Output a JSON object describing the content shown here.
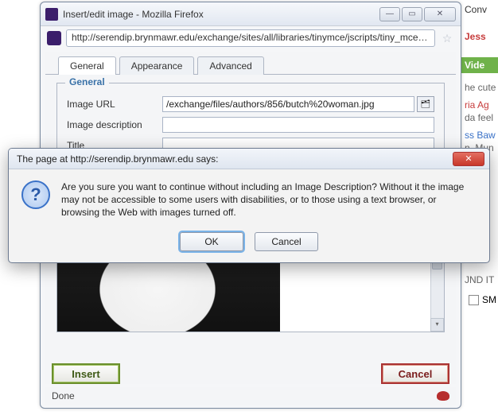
{
  "background": {
    "right_fragments": [
      "Conv",
      "Jess",
      "Vide",
      "he cute",
      "ria Ag",
      "da feel",
      "ss Baw",
      "n. Mun",
      "JND IT",
      "SM"
    ]
  },
  "window": {
    "title": "Insert/edit image - Mozilla Firefox",
    "url": "http://serendip.brynmawr.edu/exchange/sites/all/libraries/tinymce/jscripts/tiny_mce/plu"
  },
  "tabs": {
    "items": [
      "General",
      "Appearance",
      "Advanced"
    ],
    "active_index": 0
  },
  "fieldset": {
    "legend": "General",
    "rows": {
      "image_url": {
        "label": "Image URL",
        "value": "/exchange/files/authors/856/butch%20woman.jpg"
      },
      "image_description": {
        "label": "Image description",
        "value": ""
      },
      "title": {
        "label": "Title",
        "value": ""
      }
    }
  },
  "dialog_buttons": {
    "insert": "Insert",
    "cancel": "Cancel"
  },
  "status": {
    "text": "Done"
  },
  "confirm": {
    "title": "The page at http://serendip.brynmawr.edu says:",
    "message": "Are you sure you want to continue without including an Image Description? Without it the image may not be accessible to some users with disabilities, or to those using a text browser, or browsing the Web with images turned off.",
    "ok": "OK",
    "cancel": "Cancel"
  }
}
